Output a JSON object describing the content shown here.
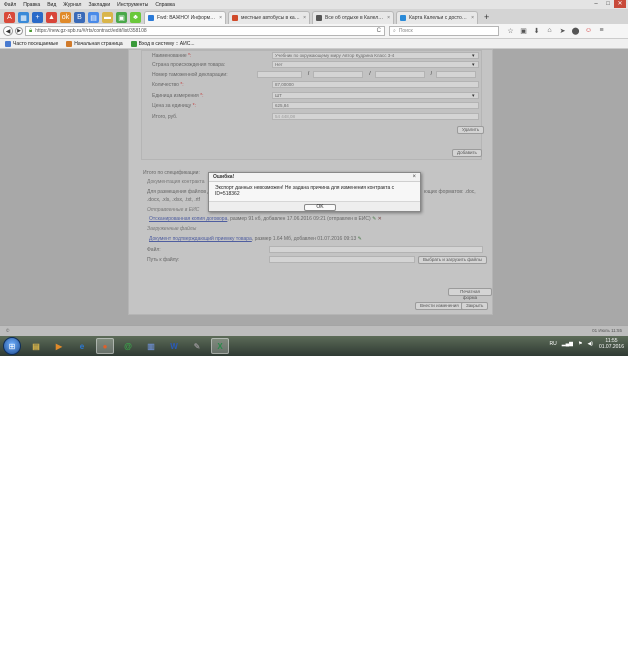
{
  "menu": [
    "Файл",
    "Правка",
    "Вид",
    "Журнал",
    "Закладки",
    "Инструменты",
    "Справка"
  ],
  "window_controls": [
    "–",
    "□",
    "✕"
  ],
  "tabs": [
    {
      "title": "Fwd: ВАЖНО! Информац...",
      "color": "#2a7ad8"
    },
    {
      "title": "местные автобусы в кале...",
      "color": "#d04a2a"
    },
    {
      "title": "Все об отдыхе в Калелье ...",
      "color": "#555555"
    },
    {
      "title": "Карта Калельи с достопр...",
      "color": "#2a8ad8"
    }
  ],
  "tab_close": "×",
  "newtab": "+",
  "nav": {
    "back": "◀",
    "forward": "▶",
    "url": "https://new.gz-spb.ru/#/rts/contract/edit/list/358108",
    "search_placeholder": "Поиск",
    "reload": "C",
    "toolbar_icons": [
      "☆",
      "▣",
      "⬇",
      "⌂",
      "➤",
      "⬤",
      "☺",
      "≡"
    ]
  },
  "bookmarks": [
    {
      "label": "Часто посещаемые",
      "color": "#4a7bd0"
    },
    {
      "label": "Начальная страница",
      "color": "#d07a2a"
    },
    {
      "label": "Вход в систему :: АИС...",
      "color": "#3a9a3a"
    }
  ],
  "form": {
    "rows": [
      {
        "label": "Наименование",
        "req": true,
        "value": "Учебник по окружающему миру Автор Кудрина Класс 3-4"
      },
      {
        "label": "Страна происхождения товара:",
        "req": false,
        "value": "Нет"
      },
      {
        "label": "Номер таможенной декларации:",
        "req": false,
        "value": ""
      },
      {
        "label": "Количество",
        "req": true,
        "value": "87,00000"
      },
      {
        "label": "Единица измерения",
        "req": true,
        "value": "ШТ"
      },
      {
        "label": "Цена за единицу",
        "req": true,
        "value": "625,84"
      },
      {
        "label": "Итого, руб.",
        "req": false,
        "value": "54 448,08"
      }
    ],
    "delete_btn": "Удалить",
    "add_btn": "Добавить"
  },
  "lower": {
    "total_label": "Итого по спецификации:",
    "docs_header": "Документация контракта",
    "placement_text": "Для размещения файлов д",
    "formats_right": "ющих форматов: .doc,",
    "formats_line2": ".docx, .xls, .xlsx, .txt, .rtf",
    "sent_header": "Отправленные в ЕИС",
    "file1_link": "Отсканированная копия договора",
    "file1_meta": ", размер 91 кб, добавлен 17.06.2016 09:21 (отправлен в ЕИС)",
    "loaded_header": "Загруженные файлы",
    "file2_link": "Документ подтверждающий приемку товара",
    "file2_meta": ", размер 1.64 Мб, добавлен 01.07.2016 09:13",
    "file_label": "Файл:",
    "path_label": "Путь к файлу:",
    "upload_btn": "Выбрать и загрузить файлы",
    "print_btn": "Печатная форма",
    "save_btn": "Внести изменения",
    "close_btn": "Закрыть"
  },
  "modal": {
    "title": "Ошибка!",
    "close": "×",
    "message": "Экспорт данных невозможен! Не задана причина для изменения контракта с ID=518362",
    "ok": "OK"
  },
  "status": {
    "left": "©",
    "right": "01 Июль 11:55"
  },
  "taskbar": {
    "apps": [
      {
        "icon": "▤",
        "color": "#d9b54a"
      },
      {
        "icon": "▶",
        "color": "#e08a2a"
      },
      {
        "icon": "e",
        "color": "#2a7ad8"
      },
      {
        "icon": "●",
        "color": "#e0602a"
      },
      {
        "icon": "@",
        "color": "#3aa84a"
      },
      {
        "icon": "▥",
        "color": "#6a8ac8"
      },
      {
        "icon": "W",
        "color": "#2a5ab8"
      },
      {
        "icon": "✎",
        "color": "#8a8a8a"
      },
      {
        "icon": "X",
        "color": "#2a8a4a"
      }
    ],
    "lang": "RU",
    "time": "11:55",
    "date": "01.07.2016"
  }
}
